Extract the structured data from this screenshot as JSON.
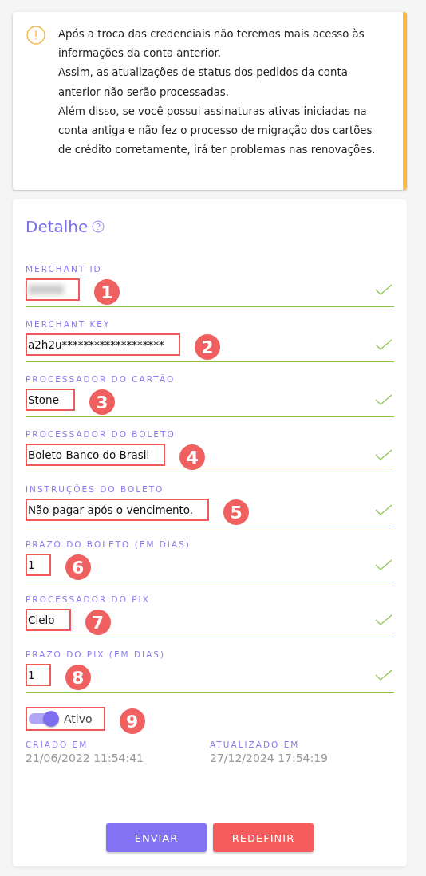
{
  "alert": {
    "lines": [
      "Após a troca das credenciais não teremos mais acesso às informações da conta anterior.",
      "Assim, as atualizações de status dos pedidos da conta anterior não serão processadas.",
      "Além disso, se você possui assinaturas ativas iniciadas na conta antiga e não fez o processo de migração dos cartões de crédito corretamente, irá ter problemas nas renovações."
    ]
  },
  "detail": {
    "title": "Detalhe",
    "fields": [
      {
        "label": "MERCHANT ID",
        "redacted": true,
        "valid": true,
        "annotation": "1"
      },
      {
        "label": "MERCHANT KEY",
        "value": "a2h2u*******************",
        "valid": true,
        "annotation": "2"
      },
      {
        "label": "PROCESSADOR DO CARTÃO",
        "value": "Stone",
        "valid": true,
        "annotation": "3"
      },
      {
        "label": "PROCESSADOR DO BOLETO",
        "value": "Boleto Banco do Brasil",
        "valid": true,
        "annotation": "4"
      },
      {
        "label": "INSTRUÇÕES DO BOLETO",
        "value": "Não pagar após o vencimento.",
        "valid": true,
        "annotation": "5"
      },
      {
        "label": "PRAZO DO BOLETO (EM DIAS)",
        "value": "1",
        "valid": true,
        "annotation": "6"
      },
      {
        "label": "PROCESSADOR DO PIX",
        "value": "Cielo",
        "valid": true,
        "annotation": "7"
      },
      {
        "label": "PRAZO DO PIX (EM DIAS)",
        "value": "1",
        "valid": true,
        "annotation": "8"
      }
    ],
    "toggle": {
      "label": "Ativo",
      "on": true,
      "annotation": "9"
    },
    "meta": [
      {
        "label": "CRIADO EM",
        "value": "21/06/2022 11:54:41"
      },
      {
        "label": "ATUALIZADO EM",
        "value": "27/12/2024 17:54:19"
      }
    ],
    "buttons": [
      {
        "label": "ENVIAR",
        "kind": "primary"
      },
      {
        "label": "REDEFINIR",
        "kind": "danger"
      }
    ]
  }
}
